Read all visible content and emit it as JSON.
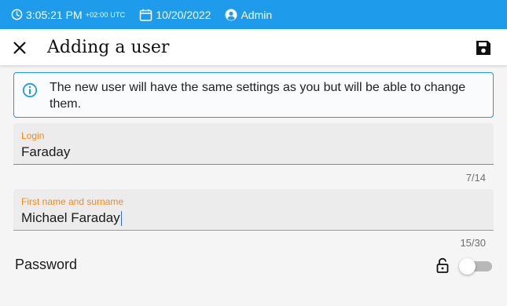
{
  "status_bar": {
    "time": "3:05:21 PM",
    "timezone": "+02:00 UTC",
    "date": "10/20/2022",
    "user": "Admin",
    "background_color": "#1e9bea",
    "icons": [
      "clock-icon",
      "calendar-icon",
      "user-icon"
    ]
  },
  "header": {
    "title": "Adding a user",
    "close_icon": "close-icon",
    "save_icon": "save-icon"
  },
  "info": {
    "text": "The new user will have the same settings as you but will be able to change them.",
    "icon": "info-icon",
    "border_color": "#1e9bea"
  },
  "form": {
    "login": {
      "label": "Login",
      "value": "Faraday",
      "counter": "7/14"
    },
    "fullname": {
      "label": "First name and surname",
      "value": "Michael Faraday",
      "counter": "15/30",
      "focused": true
    },
    "password": {
      "label": "Password",
      "lock_icon": "unlock-icon",
      "toggle_on": false
    },
    "accent_color": "#f28a1a"
  }
}
